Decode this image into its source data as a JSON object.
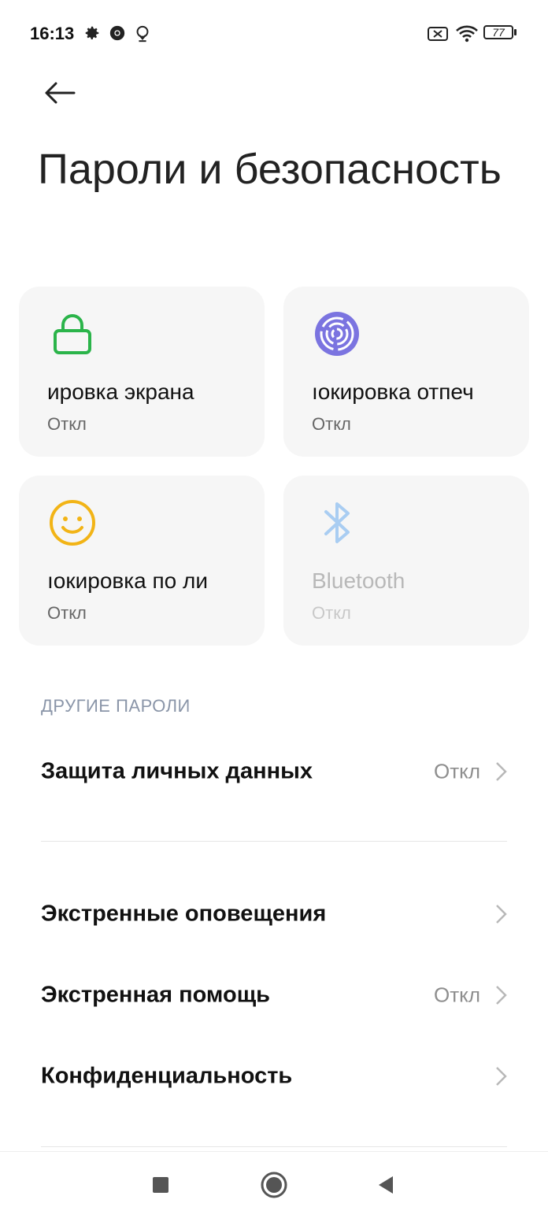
{
  "status_bar": {
    "time": "16:13",
    "battery": "77",
    "icons": [
      "gear-icon",
      "chrome-icon",
      "location-pin-icon",
      "sim-off-icon",
      "wifi-icon",
      "battery-icon"
    ]
  },
  "header": {
    "back_icon": "arrow-left-icon",
    "title": "Пароли и безопасность"
  },
  "tiles": [
    {
      "title": "ировка экрана",
      "status": "Откл",
      "icon": "lock-icon",
      "color": "#2bb44a"
    },
    {
      "title": "ıокировка отпеч",
      "status": "Откл",
      "icon": "fingerprint-icon",
      "color": "#7b74e0"
    },
    {
      "title": "ıокировка по ли",
      "status": "Откл",
      "icon": "face-icon",
      "color": "#f2b416"
    },
    {
      "title": "Bluetooth",
      "status": "Откл",
      "icon": "bluetooth-icon",
      "color": "#a9cdf2"
    }
  ],
  "section_header": "ДРУГИЕ ПАРОЛИ",
  "rows": [
    {
      "label": "Защита личных данных",
      "value": "Откл"
    },
    {
      "label": "Экстренные оповещения",
      "value": ""
    },
    {
      "label": "Экстренная помощь",
      "value": "Откл"
    },
    {
      "label": "Конфиденциальность",
      "value": ""
    }
  ],
  "nav_bar": {
    "icons": [
      "recents-square-icon",
      "home-circle-icon",
      "back-triangle-icon"
    ]
  }
}
